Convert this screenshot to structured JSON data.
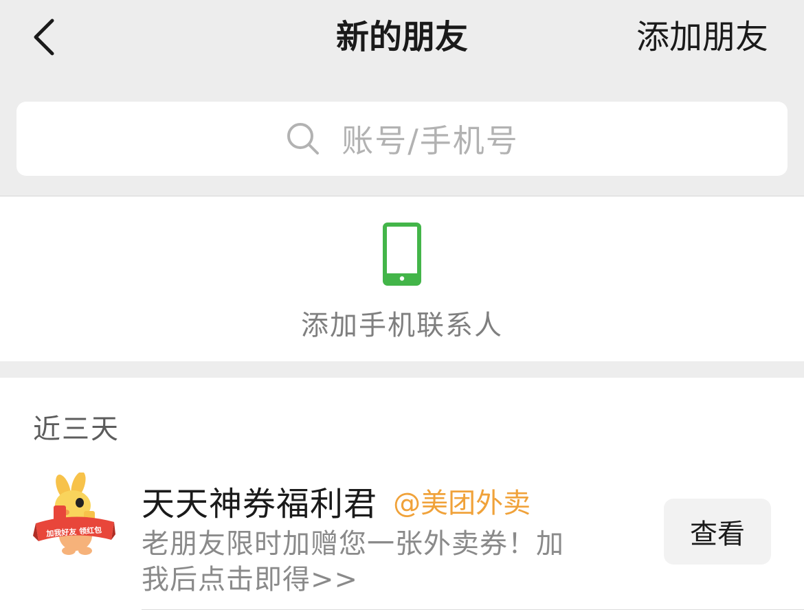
{
  "navbar": {
    "title": "新的朋友",
    "action_label": "添加朋友",
    "back_icon": "chevron-left-icon"
  },
  "search": {
    "placeholder": "账号/手机号",
    "icon": "search-icon"
  },
  "add_contacts": {
    "label": "添加手机联系人",
    "icon": "phone-icon",
    "icon_color": "#43b549"
  },
  "sections": [
    {
      "header": "近三天",
      "items": [
        {
          "name": "天天神券福利君",
          "source": "@美团外卖",
          "message": "老朋友限时加赠您一张外卖券！加我后点击即得>>",
          "button_label": "查看",
          "avatar_badge": "加我好友 领红包"
        }
      ]
    }
  ],
  "colors": {
    "background": "#ededed",
    "card": "#ffffff",
    "accent_green": "#43b549",
    "source_orange": "#f0a23a"
  }
}
